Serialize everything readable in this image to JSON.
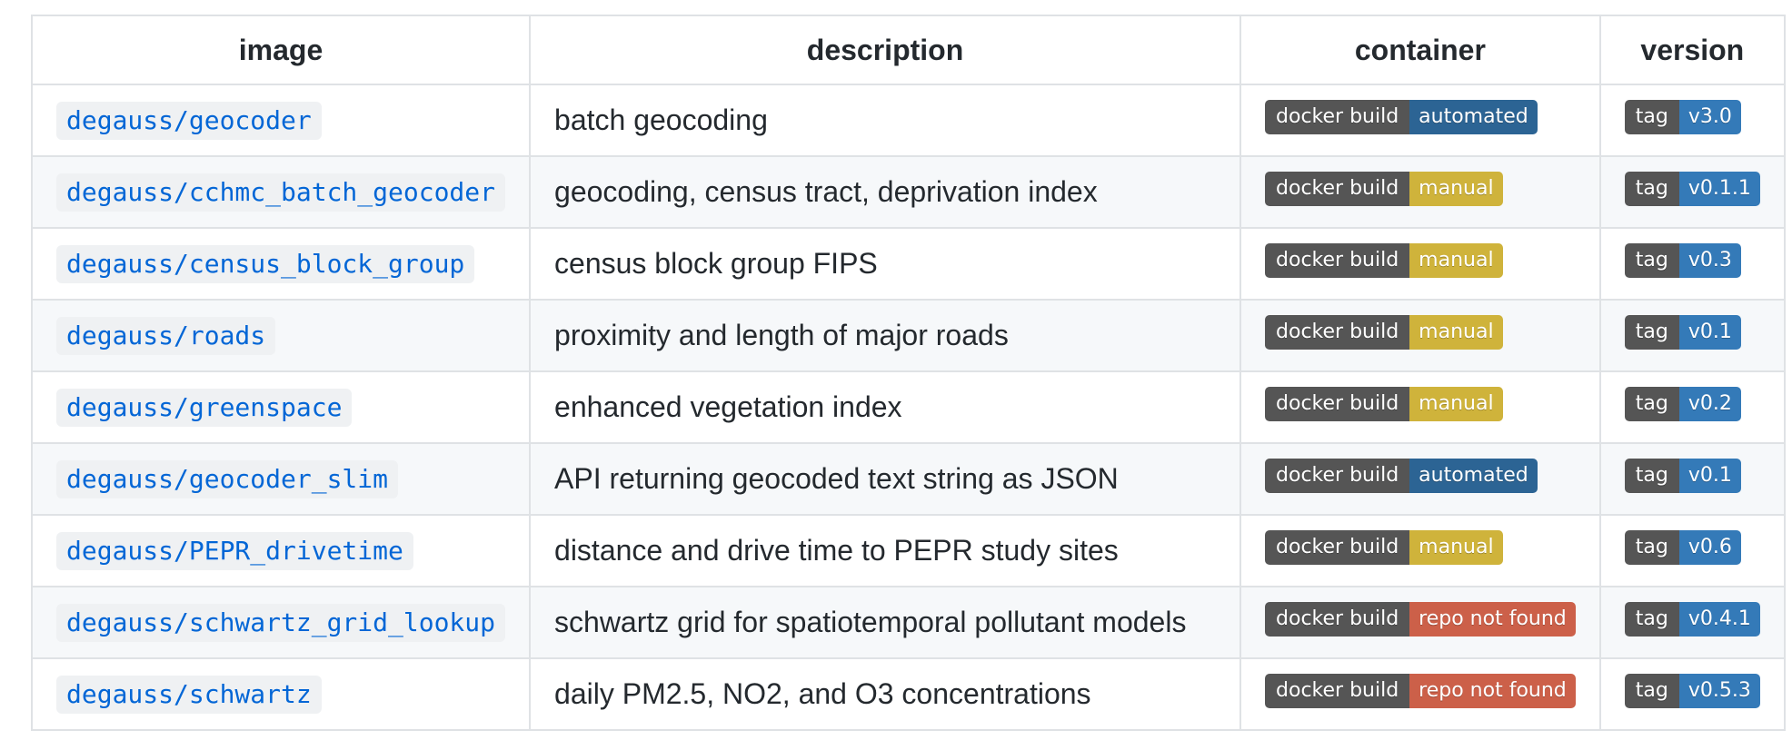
{
  "headers": {
    "image": "image",
    "description": "description",
    "container": "container",
    "version": "version"
  },
  "colors": {
    "label_bg": "#555555",
    "automated": "#2c6494",
    "manual": "#cfb33b",
    "repo_not_found": "#cc6049",
    "tag_value": "#347ab8",
    "link": "#0366d6"
  },
  "rows": [
    {
      "image": "degauss/geocoder",
      "description": "batch geocoding",
      "container_label": "docker build",
      "container_status": "automated",
      "container_color": "#2c6494",
      "version_label": "tag",
      "version": "v3.0"
    },
    {
      "image": "degauss/cchmc_batch_geocoder",
      "description": "geocoding, census tract, deprivation index",
      "container_label": "docker build",
      "container_status": "manual",
      "container_color": "#cfb33b",
      "version_label": "tag",
      "version": "v0.1.1"
    },
    {
      "image": "degauss/census_block_group",
      "description": "census block group FIPS",
      "container_label": "docker build",
      "container_status": "manual",
      "container_color": "#cfb33b",
      "version_label": "tag",
      "version": "v0.3"
    },
    {
      "image": "degauss/roads",
      "description": "proximity and length of major roads",
      "container_label": "docker build",
      "container_status": "manual",
      "container_color": "#cfb33b",
      "version_label": "tag",
      "version": "v0.1"
    },
    {
      "image": "degauss/greenspace",
      "description": "enhanced vegetation index",
      "container_label": "docker build",
      "container_status": "manual",
      "container_color": "#cfb33b",
      "version_label": "tag",
      "version": "v0.2"
    },
    {
      "image": "degauss/geocoder_slim",
      "description": "API returning geocoded text string as JSON",
      "container_label": "docker build",
      "container_status": "automated",
      "container_color": "#2c6494",
      "version_label": "tag",
      "version": "v0.1"
    },
    {
      "image": "degauss/PEPR_drivetime",
      "description": "distance and drive time to PEPR study sites",
      "container_label": "docker build",
      "container_status": "manual",
      "container_color": "#cfb33b",
      "version_label": "tag",
      "version": "v0.6"
    },
    {
      "image": "degauss/schwartz_grid_lookup",
      "description": "schwartz grid for spatiotemporal pollutant models",
      "container_label": "docker build",
      "container_status": "repo not found",
      "container_color": "#cc6049",
      "version_label": "tag",
      "version": "v0.4.1"
    },
    {
      "image": "degauss/schwartz",
      "description": "daily PM2.5, NO2, and O3 concentrations",
      "container_label": "docker build",
      "container_status": "repo not found",
      "container_color": "#cc6049",
      "version_label": "tag",
      "version": "v0.5.3"
    }
  ]
}
